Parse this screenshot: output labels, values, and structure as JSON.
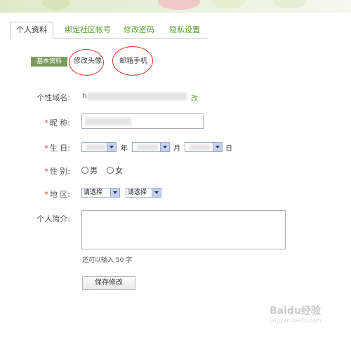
{
  "tabs": [
    {
      "label": "个人资料"
    },
    {
      "label": "绑定社区帐号"
    },
    {
      "label": "修改密码"
    },
    {
      "label": "隐私设置"
    }
  ],
  "subtabs": [
    {
      "label": "基本资料"
    },
    {
      "label": "修改头像"
    },
    {
      "label": "邮箱手机"
    }
  ],
  "form": {
    "domain_label": "个性域名:",
    "domain_prefix": "h",
    "domain_edit": "改",
    "nickname_label": "昵 称:",
    "birthday_label": "生 日:",
    "year_unit": "年",
    "month_unit": "月",
    "day_unit": "日",
    "gender_label": "性 别:",
    "gender_male": "男",
    "gender_female": "女",
    "region_label": "地 区:",
    "province_select": "请选择",
    "city_select": "请选择",
    "bio_label": "个人简介:",
    "bio_remaining": "还可以输入 50 字",
    "save_button": "保存修改",
    "required_mark": "*"
  },
  "watermark": {
    "text": "Baidu经验",
    "sub": "jingyan.baidu.com"
  },
  "colors": {
    "tab_link": "#5a9c2f",
    "subtab_active_bg": "#7f9a60",
    "annotation_circle": "#d9312b",
    "required": "#e03a2c"
  }
}
